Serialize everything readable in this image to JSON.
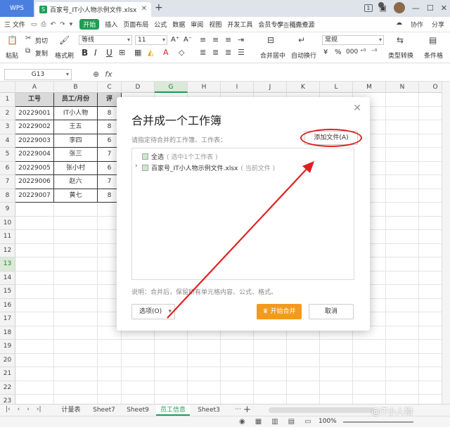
{
  "titlebar": {
    "app_tab": "WPS",
    "file_tab": "百家号_IT小人物示例文件.xlsx",
    "file_icon": "S",
    "badge": "1"
  },
  "menubar": {
    "file": "三 文件",
    "start": "开始",
    "items": [
      "插入",
      "页面布局",
      "公式",
      "数据",
      "审阅",
      "视图",
      "开发工具",
      "会员专享",
      "稻壳资源"
    ],
    "search": "查找命令...",
    "right": [
      "协作",
      "分享"
    ]
  },
  "ribbon": {
    "paste": "粘贴",
    "cut": "剪切",
    "copy": "复制",
    "format_painter": "格式刷",
    "font_name": "等线",
    "font_size": "11",
    "bold": "B",
    "italic": "I",
    "underline": "U",
    "merge": "合并居中",
    "wrap": "自动换行",
    "number_format": "常规",
    "type_convert": "类型转换",
    "cond_format": "条件格"
  },
  "formulabar": {
    "name_box": "G13",
    "fx": "fx"
  },
  "grid": {
    "columns": [
      "A",
      "B",
      "C",
      "D",
      "G",
      "H",
      "I",
      "J",
      "K",
      "L",
      "M",
      "N",
      "O"
    ],
    "rows": [
      "1",
      "2",
      "3",
      "4",
      "5",
      "6",
      "7",
      "8",
      "9",
      "10",
      "11",
      "12",
      "13",
      "14",
      "15",
      "16",
      "17",
      "18",
      "19",
      "20",
      "21",
      "22",
      "23"
    ],
    "header_row": [
      "工号",
      "员工/月份",
      "评"
    ],
    "data": [
      [
        "20229001",
        "IT小人物",
        "8"
      ],
      [
        "20229002",
        "王五",
        "8"
      ],
      [
        "20229003",
        "李四",
        "6"
      ],
      [
        "20229004",
        "张三",
        "7"
      ],
      [
        "20229005",
        "张小村",
        "6"
      ],
      [
        "20229006",
        "赵六",
        "7"
      ],
      [
        "20229007",
        "黄七",
        "8"
      ]
    ]
  },
  "sheets": {
    "tabs": [
      "计量表",
      "Sheet7",
      "Sheet9",
      "员工信息",
      "Sheet3"
    ],
    "active": "员工信息"
  },
  "status": {
    "zoom": "100%",
    "watermark": "@IT小人物"
  },
  "dialog": {
    "title": "合并成一个工作簿",
    "subtitle": "请指定待合并的工作簿、工作表：",
    "add_file": "添加文件(A)",
    "select_all": "全选",
    "select_all_hint": "( 选中1个工作表 )",
    "file_name": "百家号_IT小人物示例文件.xlsx",
    "file_hint": "( 当前文件 )",
    "note": "说明：合并后，保留所有单元格内容、公式、格式。",
    "options": "选项(O)",
    "start_merge": "开始合并",
    "cancel": "取消"
  },
  "colors": {
    "accent_green": "#1f9d55",
    "start_button": "#f39a1e",
    "annotation_red": "#e02020",
    "wps_blue": "#4a7fe0"
  }
}
